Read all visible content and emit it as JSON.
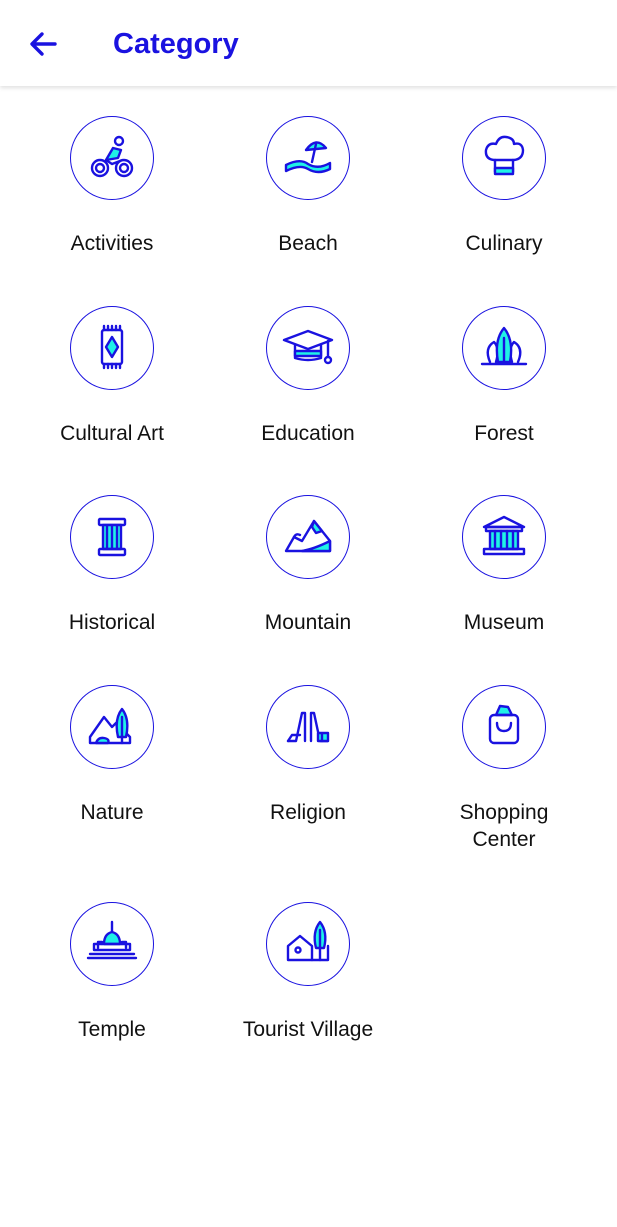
{
  "header": {
    "title": "Category",
    "back_icon": "arrow-left-icon"
  },
  "colors": {
    "accent": "#1a12e0",
    "icon_fill": "#1ff2e6",
    "text": "#111111",
    "background": "#ffffff"
  },
  "categories": [
    {
      "label": "Activities",
      "icon": "cyclist-icon"
    },
    {
      "label": "Beach",
      "icon": "beach-umbrella-icon"
    },
    {
      "label": "Culinary",
      "icon": "chef-hat-icon"
    },
    {
      "label": "Cultural Art",
      "icon": "woven-rug-icon"
    },
    {
      "label": "Education",
      "icon": "graduation-cap-icon"
    },
    {
      "label": "Forest",
      "icon": "forest-trees-icon"
    },
    {
      "label": "Historical",
      "icon": "pillar-column-icon"
    },
    {
      "label": "Mountain",
      "icon": "mountain-icon"
    },
    {
      "label": "Museum",
      "icon": "museum-building-icon"
    },
    {
      "label": "Nature",
      "icon": "nature-landscape-icon"
    },
    {
      "label": "Religion",
      "icon": "religion-gate-icon"
    },
    {
      "label": "Shopping\nCenter",
      "icon": "shopping-bag-icon"
    },
    {
      "label": "Temple",
      "icon": "temple-stupa-icon"
    },
    {
      "label": "Tourist Village",
      "icon": "village-house-icon"
    }
  ]
}
